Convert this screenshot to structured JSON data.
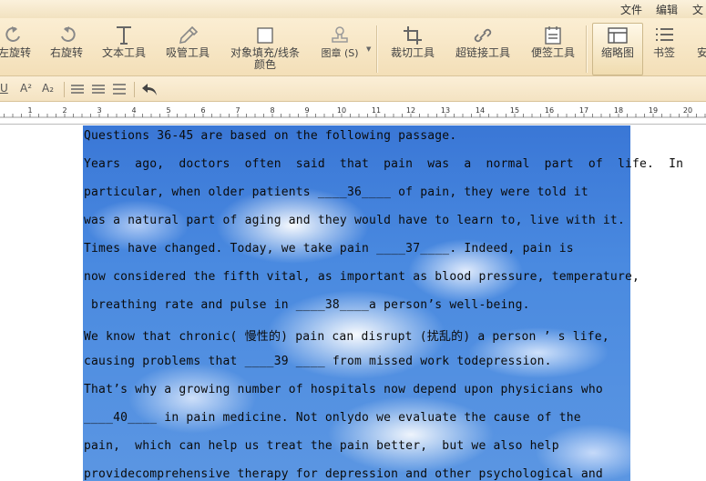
{
  "menu": {
    "items": [
      "文件",
      "编辑",
      "文"
    ]
  },
  "ribbon": {
    "tools": [
      {
        "label": "左旋转",
        "icon": "rotate-left-icon"
      },
      {
        "label": "右旋转",
        "icon": "rotate-right-icon"
      },
      {
        "label": "文本工具",
        "icon": "text-tool-icon"
      },
      {
        "label": "吸管工具",
        "icon": "eyedropper-icon"
      },
      {
        "label": "对象填充/线条",
        "label2": "颜色",
        "icon": "fill-color-icon"
      },
      {
        "label": "图章 (S)",
        "icon": "stamp-icon"
      },
      {
        "label": "裁切工具",
        "icon": "crop-icon"
      },
      {
        "label": "超链接工具",
        "icon": "link-icon"
      },
      {
        "label": "便签工具",
        "icon": "note-icon"
      },
      {
        "label": "缩略图",
        "icon": "thumbnail-icon"
      },
      {
        "label": "书签",
        "icon": "bookmark-list-icon"
      },
      {
        "label": "安",
        "icon": "security-icon"
      }
    ]
  },
  "formatbar": {
    "underline": "U",
    "superscript": "A²",
    "subscript": "A₂"
  },
  "ruler": {
    "labels": [
      "1",
      "2",
      "3",
      "4",
      "5",
      "6",
      "7",
      "8",
      "9",
      "10",
      "11",
      "12",
      "13",
      "14",
      "15",
      "16",
      "17",
      "18",
      "19",
      "20"
    ]
  },
  "document": {
    "lines": [
      "Questions 36-45 are based on the following passage.",
      "Years  ago,  doctors  often  said  that  pain  was  a  normal  part  of  life.  In",
      "particular, when older patients ____36____ of pain, they were told it",
      "was a natural part of aging and they would have to learn to, live with it.",
      "Times have changed. Today, we take pain ____37____. Indeed, pain is",
      "now considered the fifth vital, as important as blood pressure, temperature,",
      " breathing rate and pulse in ____38____a person’s well-being.",
      "We know that chronic( 慢性的) pain can disrupt (扰乱的) a person ’ s life,",
      "causing problems that ____39 ____ from missed work todepression.",
      "That’s why a growing number of hospitals now depend upon physicians who",
      "____40____ in pain medicine. Not onlydo we evaluate the cause of the",
      "pain,  which can help us treat the pain better,  but we also help",
      "providecomprehensive therapy for depression and other psychological and"
    ]
  }
}
